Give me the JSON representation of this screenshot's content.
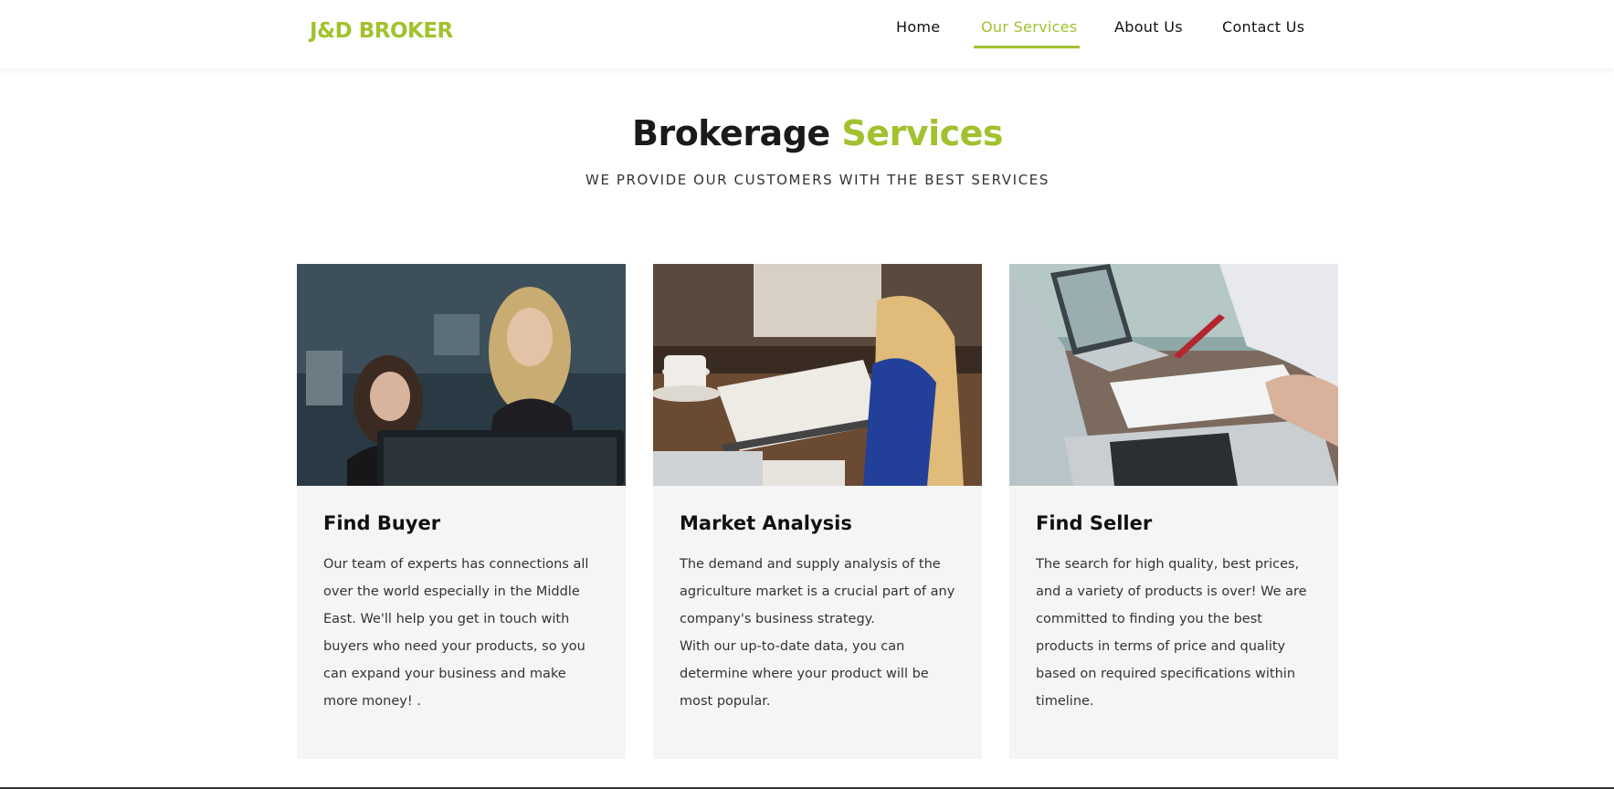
{
  "header": {
    "logo": "J&D BROKER",
    "nav": [
      {
        "label": "Home",
        "active": false
      },
      {
        "label": "Our Services",
        "active": true
      },
      {
        "label": "About Us",
        "active": false
      },
      {
        "label": "Contact Us",
        "active": false
      }
    ]
  },
  "section": {
    "title_main": "Brokerage",
    "title_accent": "Services",
    "subtitle": "WE PROVIDE OUR CUSTOMERS WITH THE BEST SERVICES"
  },
  "cards": [
    {
      "title": "Find Buyer",
      "text": "Our team of experts has connections all over the world especially in the Middle East. We'll help you get in touch with buyers who need your products, so you can expand your business and make more money! ."
    },
    {
      "title": "Market Analysis",
      "text": "The demand and supply analysis of the agriculture market is a crucial part of any company's business strategy.\nWith our up-to-date data, you can determine where your product will be most popular."
    },
    {
      "title": "Find Seller",
      "text": "The search for high quality, best prices, and a variety of products is over! We are committed to finding you the best products in terms of price and quality based on required specifications within timeline."
    }
  ],
  "colors": {
    "accent": "#a2c12e",
    "card_bg": "#f5f5f5"
  }
}
